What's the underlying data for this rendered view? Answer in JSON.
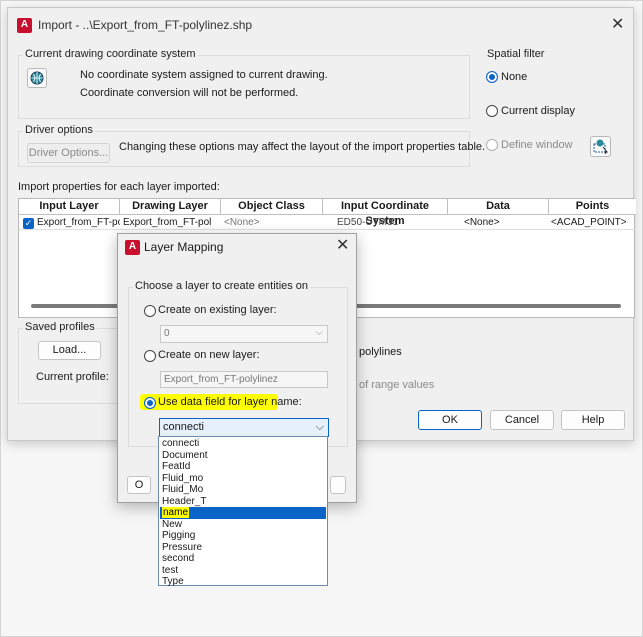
{
  "import_window": {
    "title": "Import - ..\\Export_from_FT-polylinez.shp",
    "close_glyph": "✕",
    "coord_group": {
      "label": "Current drawing coordinate system",
      "line1": "No coordinate system assigned to current drawing.",
      "line2": "Coordinate conversion will not be performed."
    },
    "spatial_filter": {
      "label": "Spatial filter",
      "options": [
        "None",
        "Current display",
        "Define window"
      ]
    },
    "driver_group": {
      "label": "Driver options",
      "button": "Driver Options...",
      "note": "Changing these options may affect the layout of the import properties table."
    },
    "table": {
      "caption": "Import properties for each layer imported:",
      "headers": [
        "Input Layer",
        "Drawing Layer",
        "Object Class",
        "Input Coordinate System",
        "Data",
        "Points"
      ],
      "row": [
        "Export_from_FT-pol",
        "Export_from_FT-pol",
        "<None>",
        "ED50-UTM31",
        "<None>",
        "<ACAD_POINT>"
      ]
    },
    "saved_profiles": {
      "label": "Saved profiles",
      "load_button": "Load...",
      "current_profile_label": "Current profile:"
    },
    "partial_texts": {
      "polylines": "polylines",
      "range": "of range values"
    },
    "buttons": {
      "ok": "OK",
      "cancel": "Cancel",
      "help": "Help"
    }
  },
  "layer_mapping": {
    "title": "Layer Mapping",
    "close_glyph": "✕",
    "group_label": "Choose a layer to create entities on",
    "opt_existing": "Create on existing layer:",
    "existing_value": "0",
    "opt_new": "Create on new layer:",
    "new_value": "Export_from_FT-polylinez",
    "opt_data": "Use data field for layer name:",
    "data_value": "connecti",
    "hidden_btn_char": "O",
    "dropdown": [
      "connecti",
      "Document",
      "FeatId",
      "Fluid_mo",
      "Fluid_Mo",
      "Header_T",
      "name",
      "New",
      "Pigging",
      "Pressure",
      "second",
      "test",
      "Type"
    ],
    "selected_item": "name"
  },
  "colors": {
    "accent": "#0a64c8",
    "highlight": "#ffff00",
    "brand_red": "#c8102e"
  }
}
